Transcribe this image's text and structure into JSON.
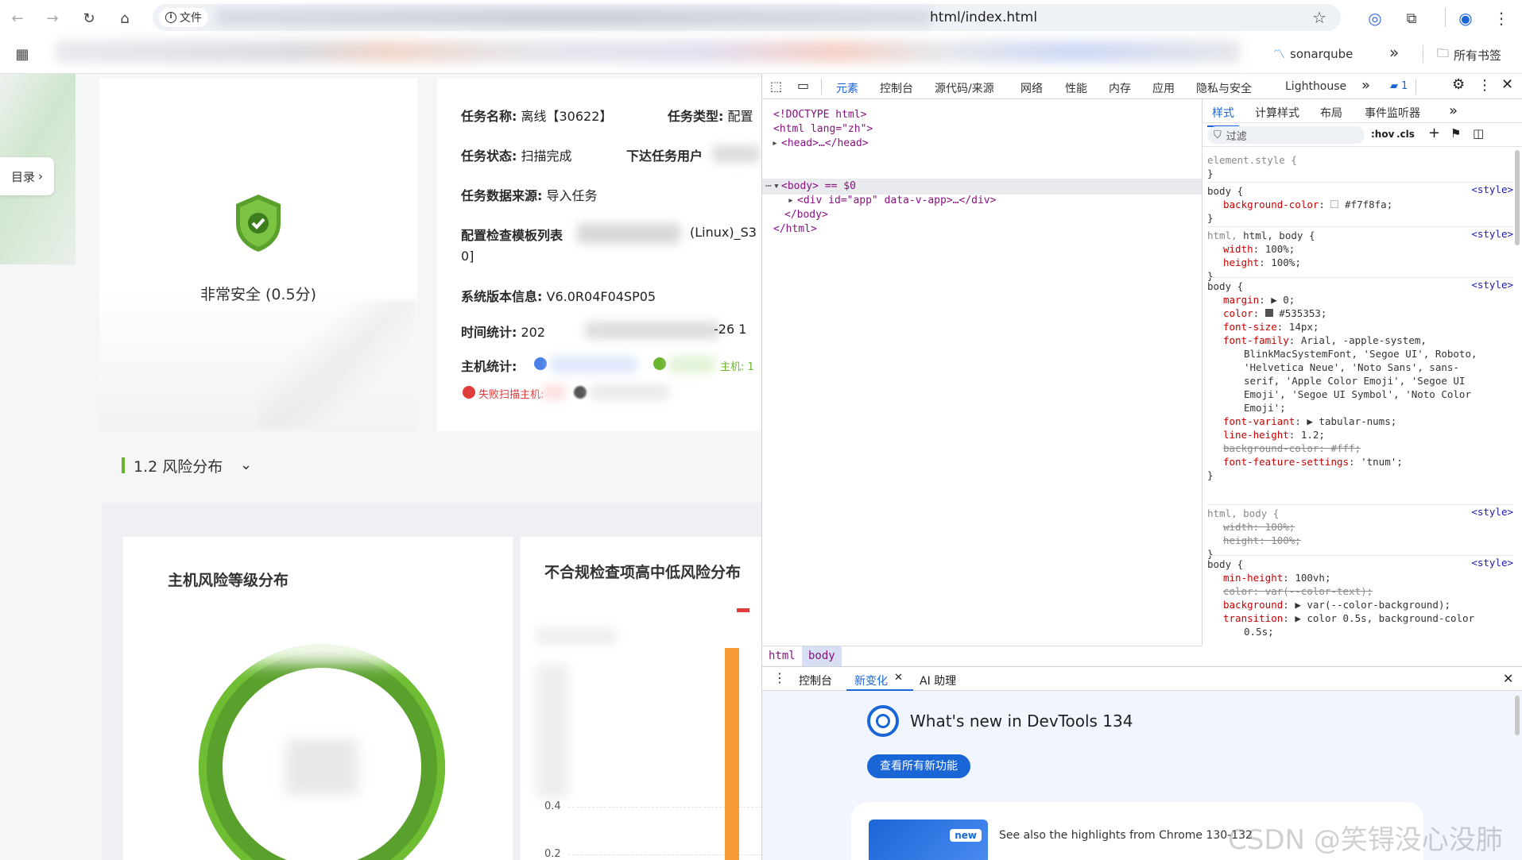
{
  "browser": {
    "info_chip": "文件",
    "url_visible": "html/index.html",
    "bookmarks": {
      "sonarqube": "sonarqube",
      "overflow": "»",
      "all_bookmarks": "所有书签"
    }
  },
  "page": {
    "sidebar_toggle": "目录",
    "security_status": "非常安全 (0.5分)",
    "task": {
      "name_label": "任务名称:",
      "name_value": "离线【30622】",
      "type_label": "任务类型:",
      "type_value": "配置",
      "status_label": "任务状态:",
      "status_value": "扫描完成",
      "issuer_label": "下达任务用户",
      "source_label": "任务数据来源:",
      "source_value": "导入任务",
      "template_label": "配置检查模板列表",
      "template_value_tail": "(Linux)_S3",
      "template_value_wrap": "0]",
      "version_label": "系统版本信息:",
      "version_value": "V6.0R04F04SP05",
      "time_label": "时间统计:",
      "time_value_head": "202",
      "time_value_tail": "-26 1",
      "host_label": "主机统计:",
      "host_chip_green_tail": "主机: 1",
      "failed_label": "失败扫描主机:"
    },
    "section_title": "1.2 风险分布",
    "chart_left_title": "主机风险等级分布",
    "chart_right_title": "不合规检查项高中低风险分布",
    "chart_data": {
      "type": "bar",
      "ytick_visible": [
        "0.4",
        "0.2"
      ]
    }
  },
  "devtools": {
    "tabs": [
      "元素",
      "控制台",
      "源代码/来源",
      "网络",
      "性能",
      "内存",
      "应用",
      "隐私与安全",
      "Lighthouse"
    ],
    "issues_count": "1",
    "dom": [
      {
        "text": "<!DOCTYPE html>"
      },
      {
        "text": "<html lang=\"zh\">"
      },
      {
        "text": "<head>…</head>"
      },
      {
        "text": "<body> == $0"
      },
      {
        "text": "<div id=\"app\" data-v-app>…</div>"
      },
      {
        "text": "</body>"
      },
      {
        "text": "</html>"
      }
    ],
    "styles_tabs": [
      "样式",
      "计算样式",
      "布局",
      "事件监听器"
    ],
    "filter_placeholder": "过滤",
    "hov": ":hov",
    "cls": ".cls",
    "rules": {
      "element_style": "element.style {",
      "src": "<style>",
      "r1_sel": "body {",
      "r1_p": "background-color",
      "r1_v": "#f7f8fa;",
      "r2_sel": "html, body {",
      "r2_p1": "width",
      "r2_v1": "100%;",
      "r2_p2": "height",
      "r2_v2": "100%;",
      "r3_sel": "body {",
      "r3_margin": "margin",
      "r3_margin_v": "▶ 0;",
      "r3_color": "color",
      "r3_color_v": "#535353;",
      "r3_fs": "font-size",
      "r3_fs_v": "14px;",
      "r3_ff": "font-family",
      "r3_ff_v1": "Arial, -apple-system,",
      "r3_ff_v2": "BlinkMacSystemFont, 'Segoe UI', Roboto,",
      "r3_ff_v3": "'Helvetica Neue', 'Noto Sans', sans-",
      "r3_ff_v4": "serif, 'Apple Color Emoji', 'Segoe UI",
      "r3_ff_v5": "Emoji', 'Segoe UI Symbol', 'Noto Color",
      "r3_ff_v6": "Emoji';",
      "r3_fv": "font-variant",
      "r3_fv_v": "▶ tabular-nums;",
      "r3_lh": "line-height",
      "r3_lh_v": "1.2;",
      "r3_bg": "background-color: #fff;",
      "r3_ffs": "font-feature-settings",
      "r3_ffs_v": "'tnum';",
      "r4_sel": "html, body {",
      "r4_w": "width: 100%;",
      "r4_h": "height: 100%;",
      "r5_sel": "body {",
      "r5_mh": "min-height",
      "r5_mh_v": "100vh;",
      "r5_color": "color: var(--color-text);",
      "r5_bg": "background",
      "r5_bg_v": "▶ var(--color-background);",
      "r5_tr": "transition",
      "r5_tr_v": "▶ color 0.5s, background-color",
      "r5_tr_v2": "0.5s;"
    },
    "breadcrumbs": [
      "html",
      "body"
    ],
    "drawer": {
      "tabs": [
        "控制台",
        "新变化",
        "AI 助理"
      ],
      "title": "What's new in DevTools 134",
      "button": "查看所有新功能",
      "badge": "new",
      "highlight": "See also the highlights from Chrome 130-132"
    }
  },
  "watermark": "CSDN @笑锝没心没肺",
  "colors": {
    "accent": "#1a66d6",
    "green": "#6ab42e",
    "orange": "#f59a34",
    "red": "#e03c3c",
    "blue": "#4a7fe6"
  }
}
